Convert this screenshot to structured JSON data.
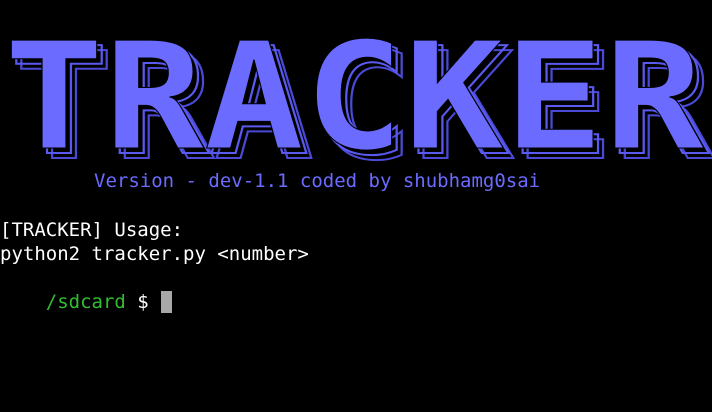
{
  "banner": {
    "title": "TRACKER",
    "color": "#6b6bff",
    "outline_color": "#4a4ad6"
  },
  "version_line": "Version - dev-1.1 coded by shubhamg0sai",
  "output": {
    "usage": "[TRACKER] Usage:",
    "command": "python2 tracker.py <number>"
  },
  "prompt": {
    "path": "/sdcard",
    "symbol": "$",
    "path_color": "#2fbf2f"
  },
  "cursor_color": "#a8a8a8"
}
